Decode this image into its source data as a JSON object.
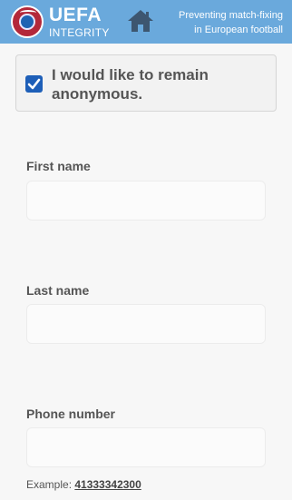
{
  "header": {
    "brand_title": "UEFA",
    "brand_subtitle": "INTEGRITY",
    "tagline_line1": "Preventing match-fixing",
    "tagline_line2": "in European football",
    "color": "#6aa9dc",
    "icons": [
      "uefa-logo-icon",
      "home-icon"
    ]
  },
  "anonymous": {
    "label": "I would like to remain anonymous.",
    "checked": true
  },
  "form": {
    "first_name": {
      "label": "First name",
      "value": "",
      "placeholder": ""
    },
    "last_name": {
      "label": "Last name",
      "value": "",
      "placeholder": ""
    },
    "phone": {
      "label": "Phone number",
      "value": "",
      "placeholder": "",
      "example_prefix": "Example: ",
      "example_value": "41333342300"
    }
  }
}
